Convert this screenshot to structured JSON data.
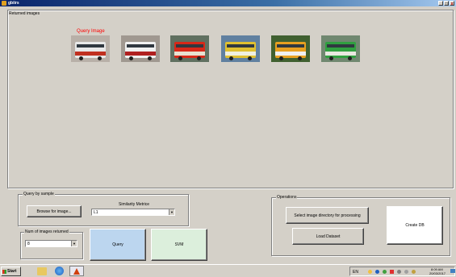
{
  "window": {
    "title": "gbiirs",
    "minimize": "_",
    "maximize": "□",
    "close": "x"
  },
  "results": {
    "label": "Returned images",
    "query_label": "Query Image",
    "thumbnails": [
      {
        "name": "bus-thumbnail-1",
        "colors": [
          "#b8b0a8",
          "#e8e8e8",
          "#c03020"
        ]
      },
      {
        "name": "bus-thumbnail-2",
        "colors": [
          "#a09890",
          "#f0f0f0",
          "#b02020"
        ]
      },
      {
        "name": "bus-thumbnail-3",
        "colors": [
          "#607060",
          "#d82818",
          "#e8e0d0"
        ]
      },
      {
        "name": "bus-thumbnail-4",
        "colors": [
          "#6080a0",
          "#e0c030",
          "#f0f0e0"
        ]
      },
      {
        "name": "bus-thumbnail-5",
        "colors": [
          "#406030",
          "#e8a020",
          "#f0f0f0"
        ]
      },
      {
        "name": "bus-thumbnail-6",
        "colors": [
          "#708870",
          "#30a040",
          "#e8e8e0"
        ]
      }
    ]
  },
  "query_by_sample": {
    "label": "Query by sample",
    "browse_button": "Browse for image...",
    "similarity_label": "Similarity Metrice",
    "similarity_value": "L1"
  },
  "num_images": {
    "label": "Num of images returned",
    "value": "8"
  },
  "buttons": {
    "query": "Query",
    "svm": "SVM"
  },
  "operations": {
    "label": "Operations",
    "select_dir": "Select image directory for processing",
    "load_dataset": "Load Dataset",
    "create_db": "Create DB"
  },
  "taskbar": {
    "start": "Start",
    "lang": "EN",
    "time": "8:09 AM",
    "date": "20/03/2017"
  }
}
